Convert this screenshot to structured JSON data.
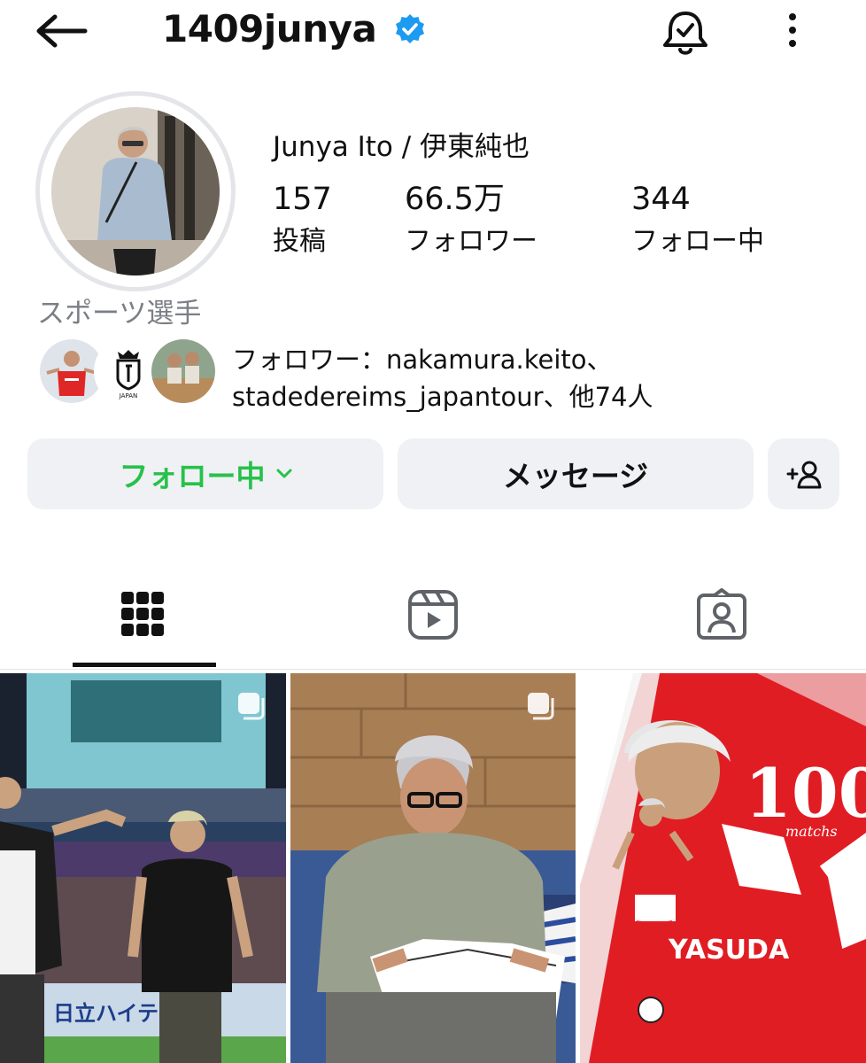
{
  "header": {
    "username": "1409junya",
    "icons": [
      "back-arrow-icon",
      "verified-badge-icon",
      "notification-bell-icon",
      "more-options-icon"
    ]
  },
  "profile": {
    "full_name": "Junya Ito / 伊東純也",
    "category": "スポーツ選手",
    "stats": [
      {
        "value": "157",
        "label": "投稿"
      },
      {
        "value": "66.5万",
        "label": "フォロワー"
      },
      {
        "value": "344",
        "label": "フォロー中"
      }
    ],
    "mutual_followers": {
      "line1": "フォロワー：nakamura.keito、",
      "line2": "stadedereims_japantour、他74人",
      "badge_text": "JAPAN"
    }
  },
  "actions": {
    "following_label": "フォロー中",
    "message_label": "メッセージ",
    "add_user_icon": "add-person-icon"
  },
  "tabs": [
    {
      "name": "posts",
      "icon": "grid-icon",
      "active": true
    },
    {
      "name": "reels",
      "icon": "reels-icon",
      "active": false
    },
    {
      "name": "tagged",
      "icon": "tagged-person-icon",
      "active": false
    }
  ],
  "posts": [
    {
      "multi": true,
      "overlay_text": "日立ハイテク"
    },
    {
      "multi": true
    },
    {
      "multi": false,
      "overlay_big": "100",
      "overlay_small": "matchs",
      "sponsor": "YASUDA"
    }
  ],
  "colors": {
    "accent_green": "#27c14a",
    "verified_blue": "#1d9bf0",
    "button_bg": "#eff1f4",
    "muted_text": "#7b7f85"
  }
}
